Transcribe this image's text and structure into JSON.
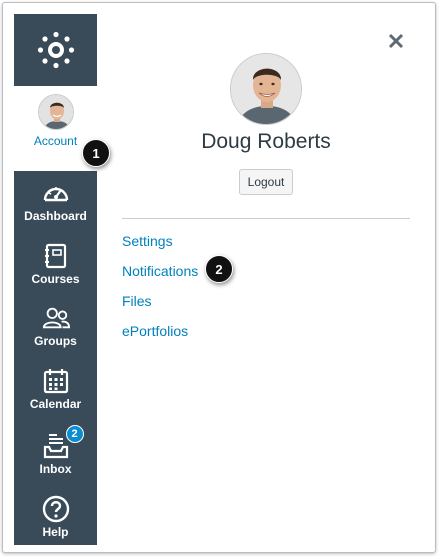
{
  "nav": {
    "logo_icon": "canvas-logo-icon",
    "account": {
      "label": "Account",
      "icon": "user-avatar"
    },
    "items": [
      {
        "key": "dashboard",
        "label": "Dashboard",
        "icon": "speedometer-icon"
      },
      {
        "key": "courses",
        "label": "Courses",
        "icon": "courses-book-icon"
      },
      {
        "key": "groups",
        "label": "Groups",
        "icon": "groups-people-icon"
      },
      {
        "key": "calendar",
        "label": "Calendar",
        "icon": "calendar-icon"
      },
      {
        "key": "inbox",
        "label": "Inbox",
        "icon": "inbox-tray-icon",
        "badge": "2"
      },
      {
        "key": "help",
        "label": "Help",
        "icon": "help-question-icon"
      }
    ]
  },
  "tray": {
    "user_name": "Doug Roberts",
    "logout_label": "Logout",
    "links": [
      {
        "key": "settings",
        "label": "Settings"
      },
      {
        "key": "notifications",
        "label": "Notifications"
      },
      {
        "key": "files",
        "label": "Files"
      },
      {
        "key": "eportfolios",
        "label": "ePortfolios"
      }
    ]
  },
  "callouts": {
    "one": "1",
    "two": "2"
  },
  "colors": {
    "nav_bg": "#394b58",
    "link": "#0081bd",
    "badge": "#0b8ed1",
    "callout": "#111111"
  }
}
